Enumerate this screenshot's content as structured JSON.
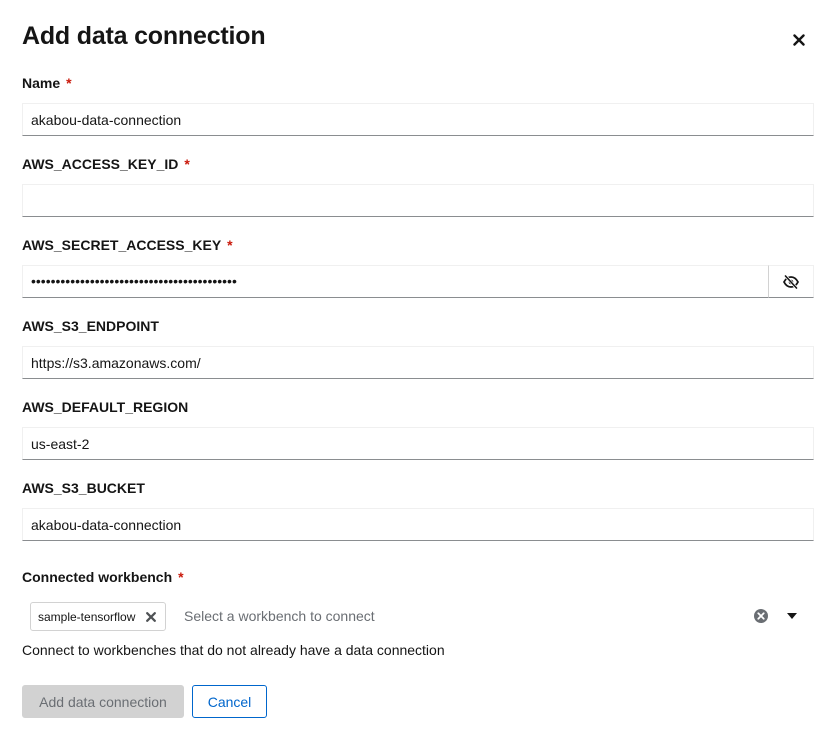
{
  "modal": {
    "title": "Add data connection",
    "close_icon": "close-icon"
  },
  "fields": {
    "name": {
      "label": "Name",
      "required": "*",
      "value": "akabou-data-connection"
    },
    "access_key": {
      "label": "AWS_ACCESS_KEY_ID",
      "required": "*",
      "value": ""
    },
    "secret_key": {
      "label": "AWS_SECRET_ACCESS_KEY",
      "required": "*",
      "value": "••••••••••••••••••••••••••••••••••••••••••",
      "toggle_icon": "eye-slash-icon"
    },
    "endpoint": {
      "label": "AWS_S3_ENDPOINT",
      "value": "https://s3.amazonaws.com/"
    },
    "region": {
      "label": "AWS_DEFAULT_REGION",
      "value": "us-east-2"
    },
    "bucket": {
      "label": "AWS_S3_BUCKET",
      "value": "akabou-data-connection"
    }
  },
  "workbench": {
    "label": "Connected workbench",
    "required": "*",
    "chips": [
      "sample-tensorflow"
    ],
    "placeholder": "Select a workbench to connect",
    "helper": "Connect to workbenches that do not already have a data connection"
  },
  "actions": {
    "submit_label": "Add data connection",
    "cancel_label": "Cancel"
  },
  "colors": {
    "required": "#c9190b",
    "link": "#0066cc",
    "disabled_bg": "#d2d2d2"
  }
}
